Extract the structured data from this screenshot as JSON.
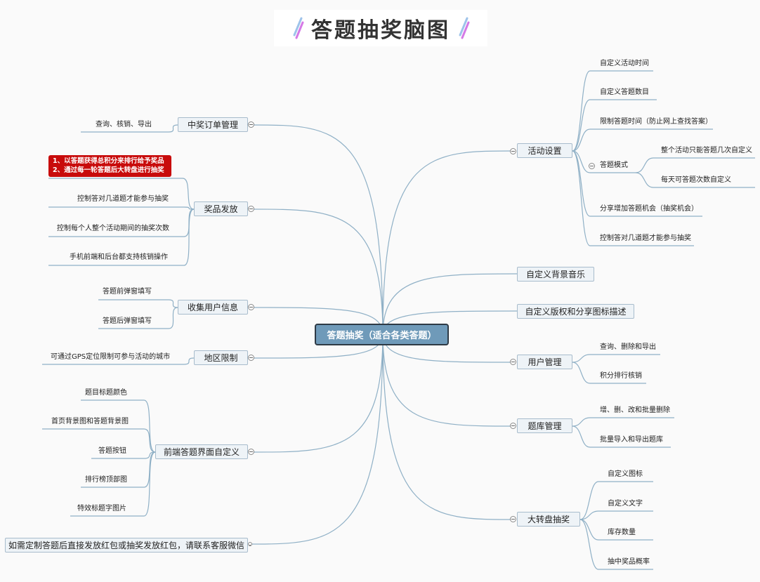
{
  "title": "答题抽奖脑图",
  "center": "答题抽奖（适合各类答题）",
  "left": {
    "order": {
      "label": "中奖订单管理",
      "children": [
        "查询、核销、导出"
      ]
    },
    "prize": {
      "label": "奖品发放",
      "highlight": [
        "1、以答题获得总积分来排行给予奖品",
        "2、通过每一轮答题后大转盘进行抽奖"
      ],
      "children": [
        "控制答对几道题才能参与抽奖",
        "控制每个人整个活动期间的抽奖次数",
        "手机前端和后台都支持核销操作"
      ]
    },
    "collect": {
      "label": "收集用户信息",
      "children": [
        "答题前弹窗填写",
        "答题后弹窗填写"
      ]
    },
    "region": {
      "label": "地区限制",
      "children": [
        "可通过GPS定位限制可参与活动的城市"
      ]
    },
    "frontend": {
      "label": "前端答题界面自定义",
      "children": [
        "题目标题颜色",
        "首页背景图和答题背景图",
        "答题按钮",
        "排行榜顶部图",
        "特效标题字图片"
      ]
    },
    "contact": {
      "label": "如需定制答题后直接发放红包或抽奖发放红包，请联系客服微信"
    }
  },
  "right": {
    "activity": {
      "label": "活动设置",
      "children": [
        "自定义活动时间",
        "自定义答题数目",
        "限制答题时间（防止网上查找答案）",
        "答题模式",
        "分享增加答题机会（抽奖机会）",
        "控制答对几道题才能参与抽奖"
      ],
      "mode_children": [
        "整个活动只能答题几次自定义",
        "每天可答题次数自定义"
      ]
    },
    "music": {
      "label": "自定义背景音乐"
    },
    "copyright": {
      "label": "自定义版权和分享图标描述"
    },
    "user": {
      "label": "用户管理",
      "children": [
        "查询、删除和导出",
        "积分排行核销"
      ]
    },
    "bank": {
      "label": "题库管理",
      "children": [
        "增、删、改和批量删除",
        "批量导入和导出题库"
      ]
    },
    "wheel": {
      "label": "大转盘抽奖",
      "children": [
        "自定义图标",
        "自定义文字",
        "库存数量",
        "抽中奖品概率"
      ]
    }
  },
  "colors": {
    "line": "#8fb0c6",
    "center": "#6f9ab9",
    "highlight": "#c80b0b"
  }
}
